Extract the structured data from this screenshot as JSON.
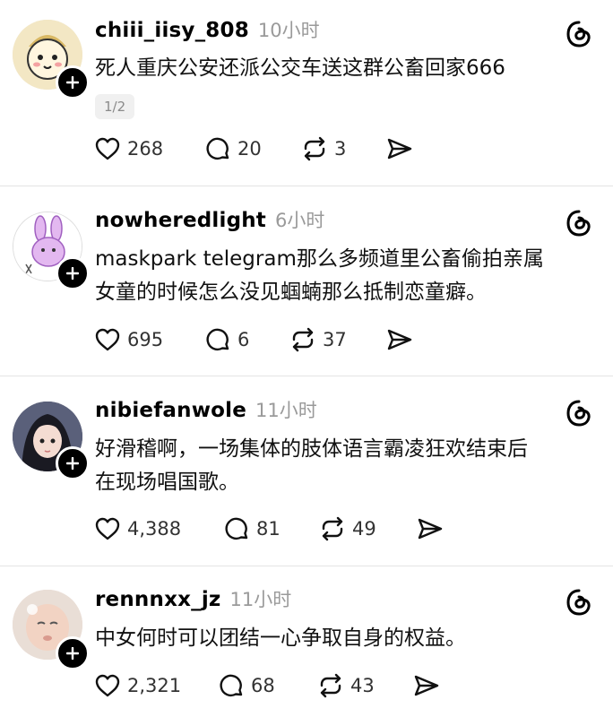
{
  "posts": [
    {
      "username": "chiii_iisy_808",
      "time": "10小时",
      "lines": [
        "死人重庆公安还派公交车送这群公畜回家666"
      ],
      "pager": "1/2",
      "likes": "268",
      "replies": "20",
      "reposts": "3"
    },
    {
      "username": "nowheredlight",
      "time": "6小时",
      "lines": [
        "maskpark telegram那么多频道里公畜偷拍亲属",
        "女童的时候怎么没见蝈蝻那么抵制恋童癖。"
      ],
      "likes": "695",
      "replies": "6",
      "reposts": "37"
    },
    {
      "username": "nibiefanwole",
      "time": "11小时",
      "lines": [
        "好滑稽啊，一场集体的肢体语言霸凌狂欢结束后",
        "在现场唱国歌。"
      ],
      "likes": "4,388",
      "replies": "81",
      "reposts": "49"
    },
    {
      "username": "rennnxx_jz",
      "time": "11小时",
      "lines": [
        "中女何时可以团结一心争取自身的权益。"
      ],
      "likes": "2,321",
      "replies": "68",
      "reposts": "43"
    }
  ],
  "icons": {
    "like": "heart-icon",
    "reply": "comment-icon",
    "repost": "repost-icon",
    "share": "send-icon",
    "follow": "plus-icon",
    "app": "threads-logo-icon"
  },
  "colors": {
    "text": "#000000",
    "muted": "#9a9a9a",
    "divider": "#e4e4e4",
    "follow_badge": "#000000"
  }
}
